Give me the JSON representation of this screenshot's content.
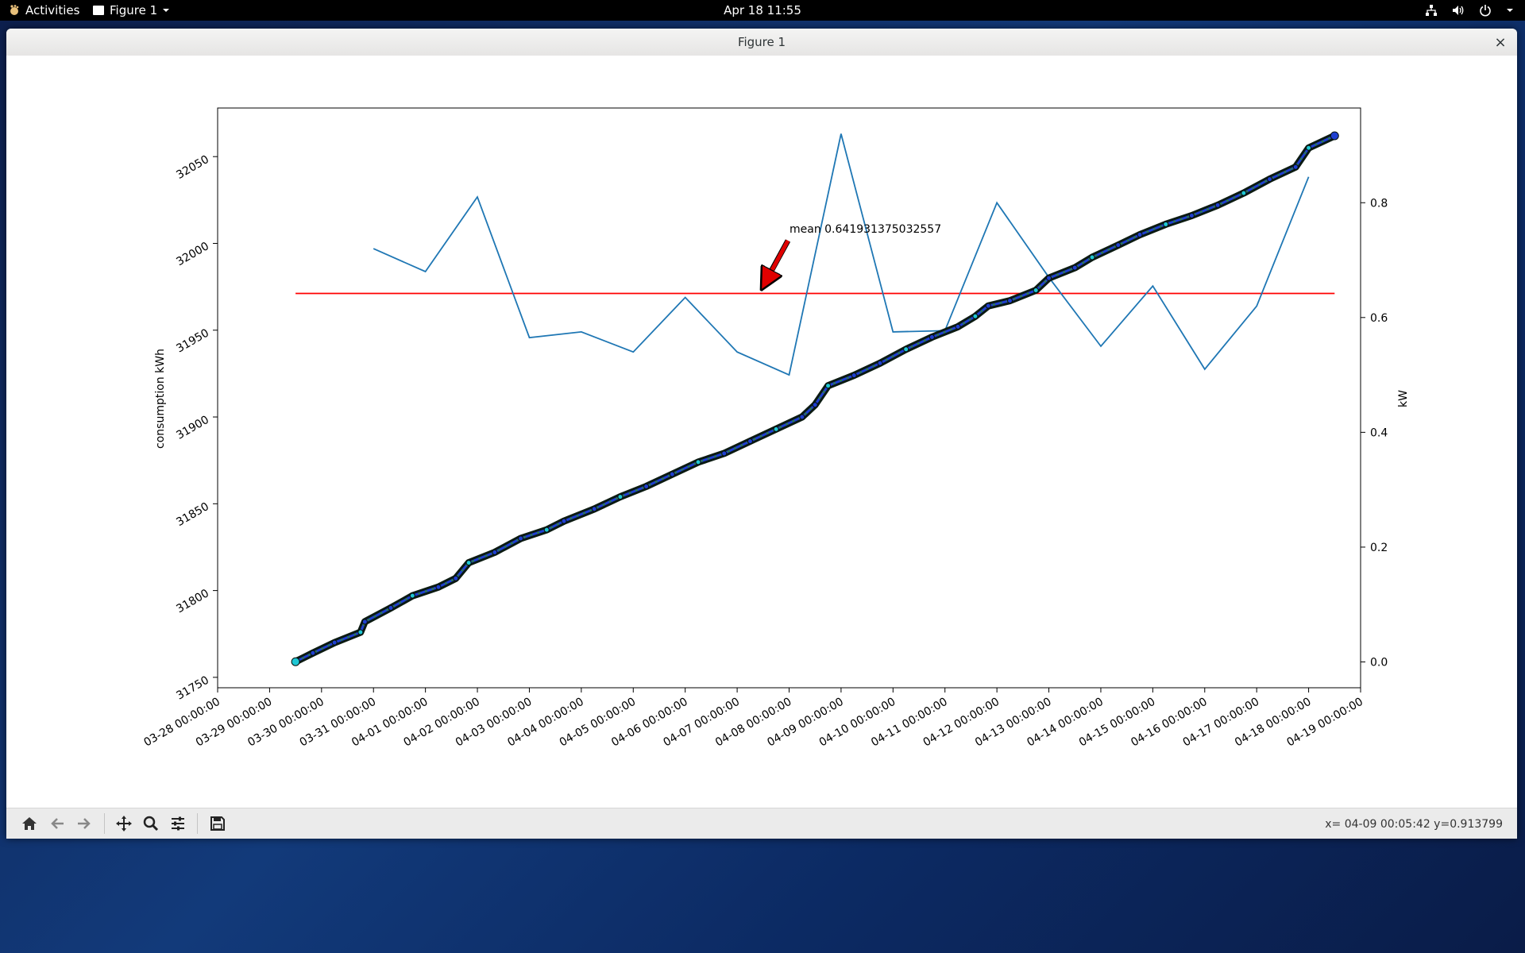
{
  "topbar": {
    "activities": "Activities",
    "app_menu": "Figure 1",
    "clock": "Apr 18  11:55"
  },
  "window": {
    "title": "Figure 1",
    "close_glyph": "×"
  },
  "toolbar": {
    "tools": [
      "home-icon",
      "back-icon",
      "forward-icon",
      "pan-icon",
      "zoom-icon",
      "configure-subplots-icon",
      "save-icon"
    ],
    "coordinates": "x=  04-09 00:05:42 y=0.913799"
  },
  "annotation": {
    "text": "mean 0.641931375032557"
  },
  "chart_data": {
    "type": "line",
    "x_axis": {
      "ticks": [
        "03-28 00:00:00",
        "03-29 00:00:00",
        "03-30 00:00:00",
        "03-31 00:00:00",
        "04-01 00:00:00",
        "04-02 00:00:00",
        "04-03 00:00:00",
        "04-04 00:00:00",
        "04-05 00:00:00",
        "04-06 00:00:00",
        "04-07 00:00:00",
        "04-08 00:00:00",
        "04-09 00:00:00",
        "04-10 00:00:00",
        "04-11 00:00:00",
        "04-12 00:00:00",
        "04-13 00:00:00",
        "04-14 00:00:00",
        "04-15 00:00:00",
        "04-16 00:00:00",
        "04-17 00:00:00",
        "04-18 00:00:00",
        "04-19 00:00:00"
      ],
      "range": [
        "03-28 00:00:00",
        "04-19 00:00:00"
      ]
    },
    "y_left": {
      "label": "consumption kWh",
      "ticks": [
        31750,
        31800,
        31850,
        31900,
        31950,
        32000,
        32050
      ],
      "range": [
        31744,
        32078
      ]
    },
    "y_right": {
      "label": "kW",
      "ticks": [
        "0.0",
        "0.2",
        "0.4",
        "0.6",
        "0.8"
      ],
      "range": [
        -0.045,
        0.965
      ]
    },
    "consumption": {
      "axis": "left",
      "color": "#1f3fd0",
      "points": [
        [
          "03-29 12:00",
          31759
        ],
        [
          "03-29 20:00",
          31764
        ],
        [
          "03-30 06:00",
          31770
        ],
        [
          "03-30 18:00",
          31776
        ],
        [
          "03-30 20:00",
          31782
        ],
        [
          "03-31 08:00",
          31790
        ],
        [
          "03-31 18:00",
          31797
        ],
        [
          "04-01 06:00",
          31802
        ],
        [
          "04-01 14:00",
          31807
        ],
        [
          "04-01 20:00",
          31816
        ],
        [
          "04-02 08:00",
          31822
        ],
        [
          "04-02 20:00",
          31830
        ],
        [
          "04-03 08:00",
          31835
        ],
        [
          "04-03 16:00",
          31840
        ],
        [
          "04-04 06:00",
          31847
        ],
        [
          "04-04 18:00",
          31854
        ],
        [
          "04-05 06:00",
          31860
        ],
        [
          "04-05 18:00",
          31867
        ],
        [
          "04-06 06:00",
          31874
        ],
        [
          "04-06 18:00",
          31879
        ],
        [
          "04-07 06:00",
          31886
        ],
        [
          "04-07 18:00",
          31893
        ],
        [
          "04-08 06:00",
          31900
        ],
        [
          "04-08 12:00",
          31907
        ],
        [
          "04-08 18:00",
          31918
        ],
        [
          "04-09 06:00",
          31924
        ],
        [
          "04-09 18:00",
          31931
        ],
        [
          "04-10 06:00",
          31939
        ],
        [
          "04-10 18:00",
          31946
        ],
        [
          "04-11 06:00",
          31952
        ],
        [
          "04-11 14:00",
          31958
        ],
        [
          "04-11 20:00",
          31964
        ],
        [
          "04-12 06:00",
          31967
        ],
        [
          "04-12 18:00",
          31973
        ],
        [
          "04-13 00:00",
          31980
        ],
        [
          "04-13 12:00",
          31986
        ],
        [
          "04-13 20:00",
          31992
        ],
        [
          "04-14 08:00",
          31999
        ],
        [
          "04-14 18:00",
          32005
        ],
        [
          "04-15 06:00",
          32011
        ],
        [
          "04-15 18:00",
          32016
        ],
        [
          "04-16 06:00",
          32022
        ],
        [
          "04-16 18:00",
          32029
        ],
        [
          "04-17 06:00",
          32037
        ],
        [
          "04-17 18:00",
          32044
        ],
        [
          "04-18 00:00",
          32055
        ],
        [
          "04-18 12:00",
          32062
        ]
      ]
    },
    "power": {
      "axis": "right",
      "color": "#1f77b4",
      "points": [
        [
          "03-31 00:00:00",
          0.72
        ],
        [
          "04-01 00:00:00",
          0.68
        ],
        [
          "04-02 00:00:00",
          0.81
        ],
        [
          "04-03 00:00:00",
          0.565
        ],
        [
          "04-04 00:00:00",
          0.575
        ],
        [
          "04-05 00:00:00",
          0.54
        ],
        [
          "04-06 00:00:00",
          0.635
        ],
        [
          "04-07 00:00:00",
          0.54
        ],
        [
          "04-08 00:00:00",
          0.5
        ],
        [
          "04-09 00:00:00",
          0.92
        ],
        [
          "04-10 00:00:00",
          0.575
        ],
        [
          "04-11 00:00:00",
          0.577
        ],
        [
          "04-12 00:00:00",
          0.8
        ],
        [
          "04-13 00:00:00",
          0.67
        ],
        [
          "04-14 00:00:00",
          0.55
        ],
        [
          "04-15 00:00:00",
          0.655
        ],
        [
          "04-16 00:00:00",
          0.51
        ],
        [
          "04-17 00:00:00",
          0.62
        ],
        [
          "04-18 00:00:00",
          0.845
        ]
      ]
    },
    "mean_line": {
      "axis": "right",
      "value": 0.641931375032557,
      "x_start": "03-29 12:00",
      "x_end": "04-18 12:00",
      "color": "#ff0000"
    }
  }
}
